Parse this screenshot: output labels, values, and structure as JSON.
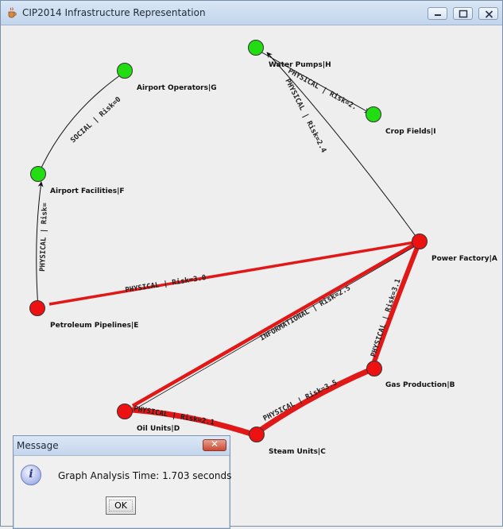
{
  "window": {
    "title": "CIP2014 Infrastructure Representation",
    "icon": "java-cup-icon",
    "controls": [
      "minimize-icon",
      "maximize-icon",
      "close-icon"
    ]
  },
  "graph": {
    "colors": {
      "green": "#22dd11",
      "red": "#ee1111",
      "red_edge": "#e01818"
    },
    "nodes": [
      {
        "id": "A",
        "label": "Power Factory|A",
        "color": "red"
      },
      {
        "id": "B",
        "label": "Gas Production|B",
        "color": "red"
      },
      {
        "id": "C",
        "label": "Steam Units|C",
        "color": "red"
      },
      {
        "id": "D",
        "label": "Oil Units|D",
        "color": "red"
      },
      {
        "id": "E",
        "label": "Petroleum Pipelines|E",
        "color": "red"
      },
      {
        "id": "F",
        "label": "Airport Facilities|F",
        "color": "green"
      },
      {
        "id": "G",
        "label": "Airport Operators|G",
        "color": "green"
      },
      {
        "id": "H",
        "label": "Water Pumps|H",
        "color": "green"
      },
      {
        "id": "I",
        "label": "Crop Fields|I",
        "color": "green"
      }
    ],
    "edges": [
      {
        "from": "F",
        "to": "G",
        "label": "SOCIAL | Risk=0",
        "highlighted": false
      },
      {
        "from": "E",
        "to": "F",
        "label": "PHYSICAL | Risk=",
        "highlighted": false
      },
      {
        "from": "A",
        "to": "E",
        "label": "PHYSICAL | Risk=3.0",
        "highlighted": true
      },
      {
        "from": "A",
        "to": "H",
        "label": "PHYSICAL | Risk=2.4",
        "highlighted": false
      },
      {
        "from": "H",
        "to": "I",
        "label": "PHYSICAL | Risk=2.",
        "highlighted": false
      },
      {
        "from": "A",
        "to": "D",
        "label": "INFORMATIONAL | Risk=2.5",
        "highlighted": true
      },
      {
        "from": "A",
        "to": "B",
        "label": "PHYSICAL | Risk=3.1",
        "highlighted": true
      },
      {
        "from": "B",
        "to": "C",
        "label": "PHYSICAL | Risk=3.5",
        "highlighted": true
      },
      {
        "from": "C",
        "to": "D",
        "label": "PHYSICAL | Risk=2.1",
        "highlighted": true
      }
    ]
  },
  "dialog": {
    "title": "Message",
    "close_icon": "close-x-icon",
    "info_icon": "information-icon",
    "info_glyph": "i",
    "message": "Graph Analysis Time: 1.703 seconds",
    "ok_label": "OK"
  }
}
